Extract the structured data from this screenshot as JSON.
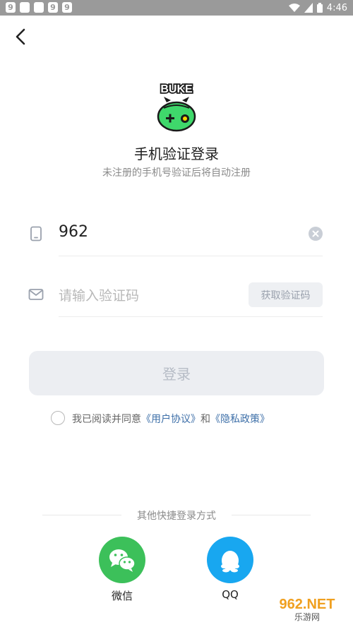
{
  "status_bar": {
    "time": "4:46",
    "notification_icons": [
      "9",
      "",
      "",
      "9",
      "9"
    ]
  },
  "header": {
    "back_icon": "chevron-left-icon"
  },
  "brand": {
    "logo_text": "BUKE"
  },
  "login": {
    "title": "手机验证登录",
    "subtitle": "未注册的手机号验证后将自动注册",
    "phone_value": "962",
    "code_placeholder": "请输入验证码",
    "get_code_label": "获取验证码",
    "login_button": "登录"
  },
  "agreement": {
    "prefix": "我已阅读并同意",
    "user_agreement": "《用户协议》",
    "and": "和",
    "privacy_policy": "《隐私政策》"
  },
  "other_login": {
    "label": "其他快捷登录方式",
    "options": [
      {
        "label": "微信",
        "icon": "wechat-icon"
      },
      {
        "label": "QQ",
        "icon": "qq-icon"
      }
    ]
  },
  "watermark": {
    "brand": "962.NET",
    "sub": "乐游网"
  },
  "colors": {
    "status_bar": "#9a9a9a",
    "wechat": "#3cc05a",
    "qq": "#18a7f0",
    "link": "#3d6fa8",
    "logo_green": "#3fd86b"
  }
}
